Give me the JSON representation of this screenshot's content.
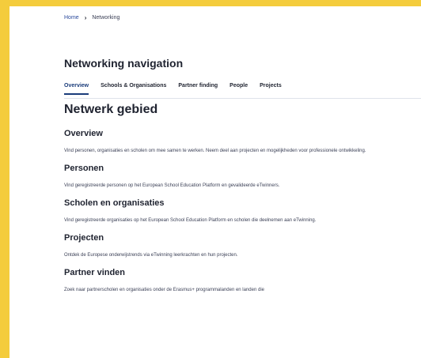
{
  "breadcrumb": {
    "home": "Home",
    "separator": "›",
    "current": "Networking"
  },
  "nav": {
    "title": "Networking navigation",
    "tabs": [
      {
        "label": "Overview",
        "active": true
      },
      {
        "label": "Schools & Organisations",
        "active": false
      },
      {
        "label": "Partner finding",
        "active": false
      },
      {
        "label": "People",
        "active": false
      },
      {
        "label": "Projects",
        "active": false
      }
    ]
  },
  "main": {
    "heading": "Netwerk gebied",
    "sections": [
      {
        "title": "Overview",
        "text": "Vind personen, organisaties en scholen om mee samen te werken. Neem deel aan projecten en mogelijkheden voor professionele ontwikkeling."
      },
      {
        "title": "Personen",
        "text": "Vind geregistreerde personen op het European School Education Platform en gevalideerde eTwinners."
      },
      {
        "title": "Scholen en organisaties",
        "text": "Vind geregistreerde organisaties op het European School Education Platform en scholen die deelnemen aan eTwinning."
      },
      {
        "title": "Projecten",
        "text": "Ontdek de Europese onderwijstrends via eTwinning leerkrachten en hun projecten."
      },
      {
        "title": "Partner vinden",
        "text": "Zoek naar partnerscholen en organisaties onder de Erasmus+ programmalanden en landen die"
      }
    ]
  },
  "colors": {
    "frame": "#f4cc3c",
    "active_tab": "#1a3c7a",
    "link": "#2a4a9c"
  }
}
